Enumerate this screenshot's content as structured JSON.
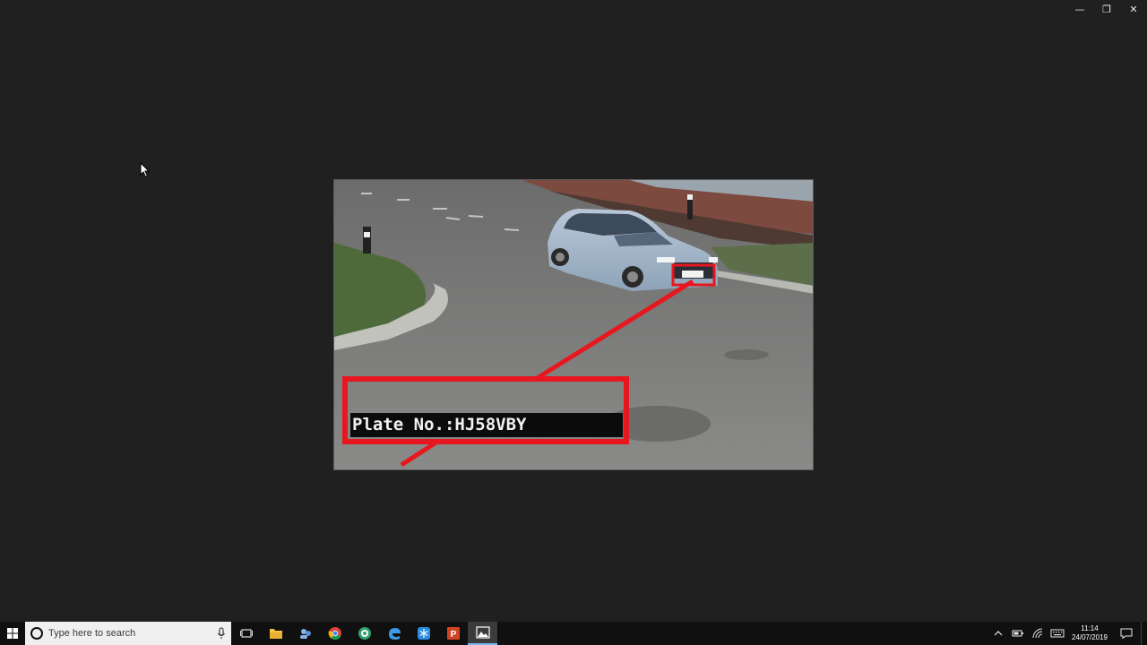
{
  "window": {
    "controls": {
      "minimize_glyph": "—",
      "restore_glyph": "❐",
      "close_glyph": "✕"
    }
  },
  "viewer": {
    "image_caption": "Plate No.:HJ58VBY",
    "plate_detected": "HJ58VBY",
    "overlay_color": "#e8161e"
  },
  "taskbar": {
    "search_placeholder": "Type here to search",
    "pinned": [
      {
        "name": "task-view-icon"
      },
      {
        "name": "file-explorer-icon"
      },
      {
        "name": "people-icon"
      },
      {
        "name": "chrome-icon"
      },
      {
        "name": "snip-icon"
      },
      {
        "name": "edge-browser-icon"
      },
      {
        "name": "snowflake-app-icon"
      },
      {
        "name": "powerpoint-icon"
      },
      {
        "name": "photos-icon",
        "running": true
      }
    ],
    "clock": {
      "time": "11:14",
      "date": "24/07/2019"
    }
  }
}
